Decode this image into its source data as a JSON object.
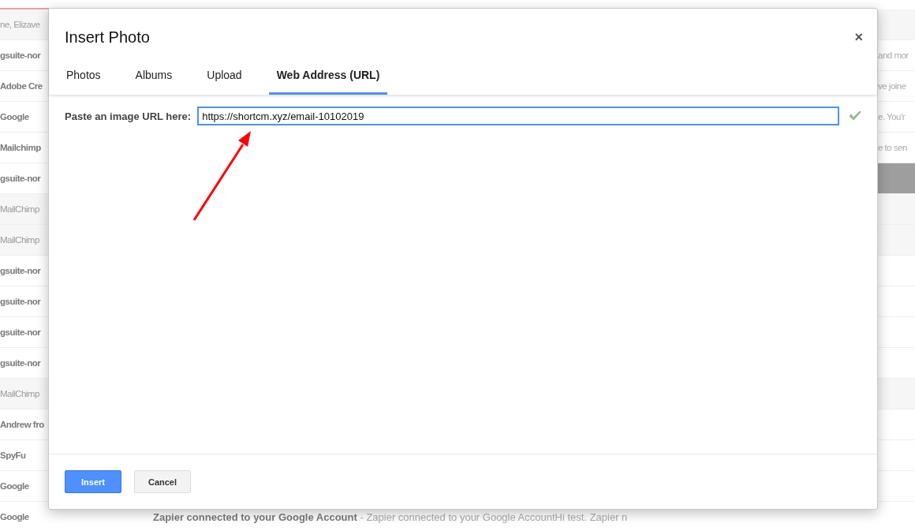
{
  "background_list": {
    "rows": [
      {
        "sender": "ne, Elizave",
        "read": true,
        "snippet": ""
      },
      {
        "sender": "gsuite-nor",
        "read": false,
        "snippet": "and mor"
      },
      {
        "sender": "Adobe Cre",
        "read": false,
        "snippet": "ve joine"
      },
      {
        "sender": "Google",
        "read": false,
        "snippet": "e. You'r"
      },
      {
        "sender": "Mailchimp",
        "read": false,
        "snippet": "e to sen"
      },
      {
        "sender": "gsuite-nor",
        "read": false,
        "snippet": "",
        "selected": true
      },
      {
        "sender": "MailChimp",
        "read": true,
        "snippet": ""
      },
      {
        "sender": "MailChimp",
        "read": true,
        "snippet": ""
      },
      {
        "sender": "gsuite-nor",
        "read": false,
        "snippet": ""
      },
      {
        "sender": "gsuite-nor",
        "read": false,
        "snippet": ""
      },
      {
        "sender": "gsuite-nor",
        "read": false,
        "snippet": ""
      },
      {
        "sender": "gsuite-nor",
        "read": false,
        "snippet": ""
      },
      {
        "sender": "MailChimp",
        "read": true,
        "snippet": ""
      },
      {
        "sender": "Andrew fro",
        "read": false,
        "snippet": ""
      },
      {
        "sender": "SpyFu",
        "read": false,
        "snippet": ""
      },
      {
        "sender": "Google",
        "read": false,
        "snippet": ""
      },
      {
        "sender": "Google",
        "read": false,
        "snippet": "",
        "subject": "**Zapier connected to your Google Account** - Zapier connected to your Google AccountHi test. Zapier n"
      }
    ]
  },
  "dialog": {
    "title": "Insert Photo",
    "close": "×",
    "tabs": [
      {
        "label": "Photos",
        "selected": false
      },
      {
        "label": "Albums",
        "selected": false
      },
      {
        "label": "Upload",
        "selected": false
      },
      {
        "label": "Web Address (URL)",
        "selected": true
      }
    ],
    "url_label": "Paste an image URL here:",
    "url_value": "https://shortcm.xyz/email-10102019",
    "url_valid": true,
    "buttons": [
      {
        "label": "Insert",
        "kind": "primary"
      },
      {
        "label": "Cancel",
        "kind": "secondary"
      }
    ]
  }
}
